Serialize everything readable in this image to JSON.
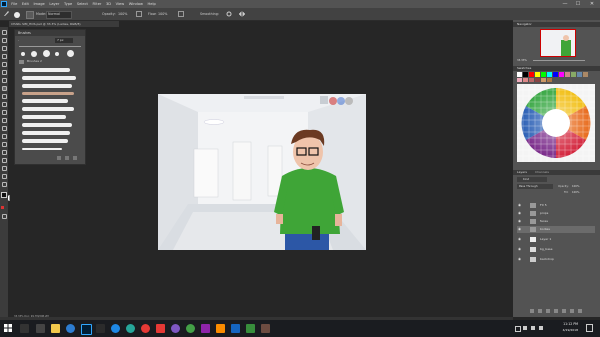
{
  "menu": [
    "File",
    "Edit",
    "Image",
    "Layer",
    "Type",
    "Select",
    "Filter",
    "3D",
    "View",
    "Window",
    "Help"
  ],
  "window_controls": {
    "minimize": "—",
    "maximize": "☐",
    "close": "✕"
  },
  "options_bar": {
    "mode_label": "Mode:",
    "mode_value": "Normal",
    "opacity_label": "Opacity:",
    "opacity_value": "100%",
    "flow_label": "Flow:",
    "flow_value": "100%",
    "smoothing_label": "Smoothing:"
  },
  "document_tab": {
    "title": "CHARL SIM_HOS.psd @ 33.3% (Ladies, RGB/8)"
  },
  "brush_panel": {
    "title": "Brushes",
    "size_value": "7 px",
    "folder_label": "Brushes 2"
  },
  "navigator": {
    "title": "Navigator",
    "zoom": "33.33%"
  },
  "swatches": {
    "title": "Swatches"
  },
  "layers_panel": {
    "tab_layers": "Layers",
    "tab_channels": "Channels",
    "filter_label": "Kind",
    "blend_mode": "Pass Through",
    "opacity_label": "Opacity:",
    "opacity_value": "100%",
    "fill_label": "Fill:",
    "fill_value": "100%",
    "layers": [
      {
        "name": "FX 5",
        "type": "folder"
      },
      {
        "name": "props",
        "type": "folder"
      },
      {
        "name": "faces",
        "type": "folder"
      },
      {
        "name": "bodies",
        "type": "folder",
        "selected": true
      },
      {
        "name": "Layer 1",
        "type": "layer"
      },
      {
        "name": "bg_base",
        "type": "layer"
      },
      {
        "name": "backdrop",
        "type": "layer"
      }
    ]
  },
  "status_bar": {
    "zoom": "33.33%",
    "doc": "Doc: 99.7M/298.2M"
  },
  "taskbar": {
    "time": "11:12 PM",
    "date": "4/19/2018",
    "apps": [
      "windows-start",
      "search",
      "task-view",
      "file-explorer",
      "edge",
      "chrome",
      "photoshop",
      "illustrator",
      "app",
      "app",
      "app",
      "app",
      "app",
      "app",
      "app",
      "app",
      "app"
    ]
  },
  "colors": {
    "accent": "#31a8ff",
    "ui_dark": "#262626",
    "panel": "#535353"
  }
}
